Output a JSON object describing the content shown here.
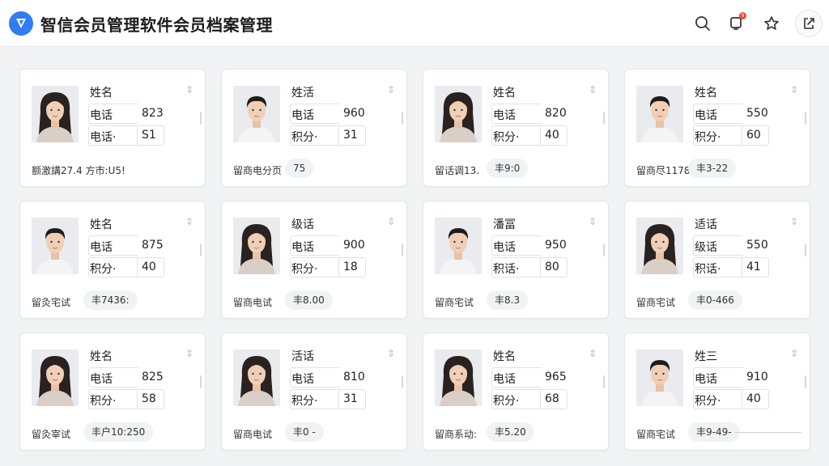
{
  "app": {
    "title": "智信会员管理软件会员档案管理",
    "notification_count": "9",
    "brand_color": "#2f7cf6"
  },
  "toolbar": {
    "icons": [
      "search-icon",
      "bell-icon",
      "star-icon",
      "exit-icon"
    ]
  },
  "cards": [
    {
      "name": "姓名",
      "label1": "电话",
      "value1": "823",
      "label2": "电话·",
      "value2": "S1",
      "footer_label": "额激講27.4 方市:U5!",
      "footer_value": "",
      "gender": "f"
    },
    {
      "name": "姓活",
      "label1": "电话",
      "value1": "960",
      "label2": "积分·",
      "value2": "31",
      "footer_label": "留商电分页",
      "footer_value": "75",
      "gender": "m"
    },
    {
      "name": "姓名",
      "label1": "电话",
      "value1": "820",
      "label2": "积分·",
      "value2": "40",
      "footer_label": "留话调13.",
      "footer_value": "丰9:0",
      "gender": "f"
    },
    {
      "name": "姓名",
      "label1": "电话",
      "value1": "550",
      "label2": "积分·",
      "value2": "60",
      "footer_label": "留商尽1178",
      "footer_value": "丰3-22",
      "gender": "m"
    },
    {
      "name": "姓名",
      "label1": "电话",
      "value1": "875",
      "label2": "积分·",
      "value2": "40",
      "footer_label": "留灸宅试",
      "footer_value": "丰7436:",
      "gender": "m"
    },
    {
      "name": "级话",
      "label1": "电话",
      "value1": "900",
      "label2": "积分·",
      "value2": "18",
      "footer_label": "留商电试",
      "footer_value": "丰8.00",
      "gender": "f"
    },
    {
      "name": "潘冨",
      "label1": "电话",
      "value1": "950",
      "label2": "积话·",
      "value2": "80",
      "footer_label": "留商宅试",
      "footer_value": "丰8.3",
      "gender": "m"
    },
    {
      "name": "适话",
      "label1": "级话",
      "value1": "550",
      "label2": "积话·",
      "value2": "41",
      "footer_label": "留商宅试",
      "footer_value": "丰0-466",
      "gender": "f"
    },
    {
      "name": "姓名",
      "label1": "电话",
      "value1": "825",
      "label2": "积分·",
      "value2": "58",
      "footer_label": "留灸宰试",
      "footer_value": "丰户10:250",
      "gender": "f"
    },
    {
      "name": "活话",
      "label1": "电话",
      "value1": "810",
      "label2": "积分·",
      "value2": "31",
      "footer_label": "留商电试",
      "footer_value": "丰0 -",
      "gender": "f"
    },
    {
      "name": "姓名",
      "label1": "电话",
      "value1": "965",
      "label2": "积分·",
      "value2": "68",
      "footer_label": "留商系动:",
      "footer_value": "丰5.20",
      "gender": "f"
    },
    {
      "name": "姓三",
      "label1": "电话",
      "value1": "910",
      "label2": "积分·",
      "value2": "40",
      "footer_label": "留商宅试",
      "footer_value": "丰9-49-",
      "gender": "m"
    }
  ]
}
